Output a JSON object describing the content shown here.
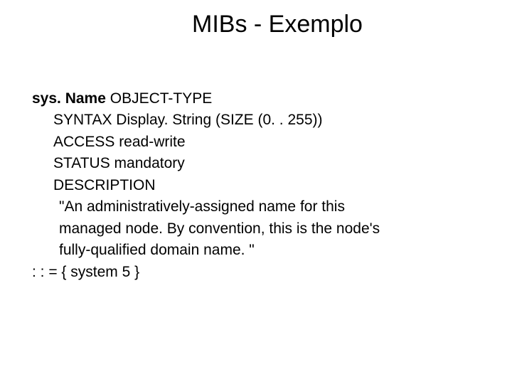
{
  "title": "MIBs - Exemplo",
  "lines": {
    "l0_bold": "sys. Name",
    "l0_rest": " OBJECT-TYPE",
    "l1": "SYNTAX Display. String (SIZE (0. . 255))",
    "l2": "ACCESS read-write",
    "l3": "STATUS mandatory",
    "l4": "DESCRIPTION",
    "l5": "\"An administratively-assigned name for this",
    "l6": "managed node. By convention, this is the node's",
    "l7": "fully-qualified domain name. \"",
    "l8": ": : = { system 5 }"
  }
}
